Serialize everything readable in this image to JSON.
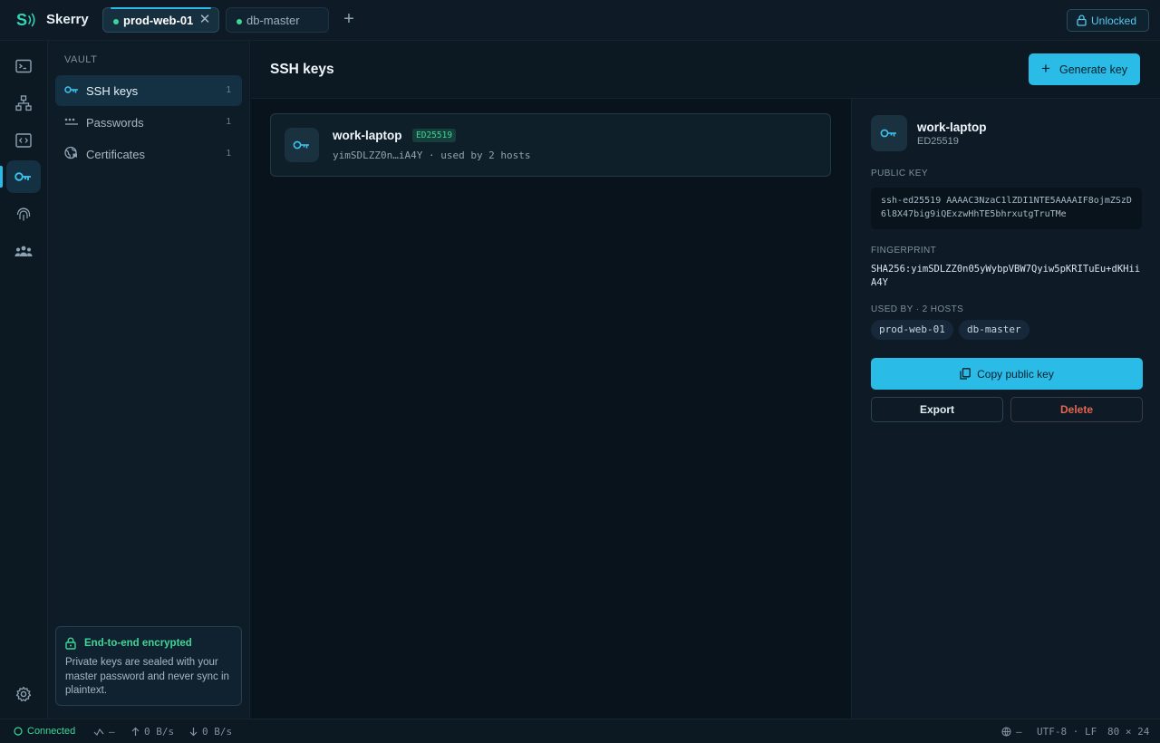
{
  "app": {
    "name": "Skerry",
    "logo_glyph": "S"
  },
  "tabs": [
    {
      "label": "prod-web-01",
      "status": "connected",
      "active": true,
      "close_glyph": "✕"
    },
    {
      "label": "db-master",
      "status": "connected",
      "active": false
    }
  ],
  "topbar": {
    "add_tab_glyph": "+",
    "lock_status": "Unlocked"
  },
  "rail": {
    "items": [
      "terminal-icon",
      "network-icon",
      "code-icon",
      "key-icon",
      "fingerprint-icon",
      "team-icon"
    ],
    "active": "key-icon",
    "bottom": "gear-icon"
  },
  "sidebar": {
    "section": "VAULT",
    "items": [
      {
        "label": "SSH keys",
        "count": "1",
        "icon": "key-icon"
      },
      {
        "label": "Passwords",
        "count": "1",
        "icon": "password-icon"
      },
      {
        "label": "Certificates",
        "count": "1",
        "icon": "certificate-icon"
      }
    ],
    "encryption": {
      "title": "End-to-end encrypted",
      "body": "Private keys are sealed with your master password and never sync in plaintext."
    }
  },
  "main": {
    "title": "SSH keys",
    "generate_label": "Generate key",
    "generate_glyph": "+",
    "keys": [
      {
        "name": "work-laptop",
        "type": "ED25519",
        "meta": "yimSDLZZ0n…iA4Y · used by 2 hosts"
      }
    ]
  },
  "detail": {
    "name": "work-laptop",
    "type": "ED25519",
    "public_key_label": "PUBLIC KEY",
    "public_key": "ssh-ed25519 AAAAC3NzaC1lZDI1NTE5AAAAIF8ojmZSzD6l8X47big9iQExzwHhTE5bhrxutgTruTMe",
    "fingerprint_label": "FINGERPRINT",
    "fingerprint": "SHA256:yimSDLZZ0n05yWybpVBW7Qyiw5pKRITuEu+dKHiiA4Y",
    "used_by_label": "USED BY · 2 HOSTS",
    "hosts": [
      "prod-web-01",
      "db-master"
    ],
    "copy_label": "Copy public key",
    "export_label": "Export",
    "delete_label": "Delete"
  },
  "status": {
    "connection": "Connected",
    "latency": "—",
    "upload": "0 B/s",
    "download": "0 B/s",
    "globe": "—",
    "encoding": "UTF-8 · LF",
    "size": "80 × 24"
  },
  "colors": {
    "accent": "#2bbbe7",
    "success": "#3ed598",
    "danger": "#e5654f",
    "background": "#0b1620"
  }
}
